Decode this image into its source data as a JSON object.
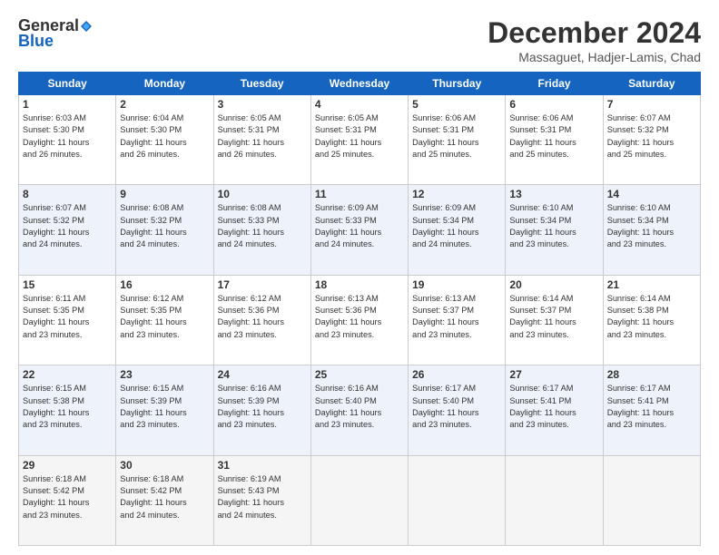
{
  "logo": {
    "line1": "General",
    "line2": "Blue"
  },
  "title": "December 2024",
  "subtitle": "Massaguet, Hadjer-Lamis, Chad",
  "headers": [
    "Sunday",
    "Monday",
    "Tuesday",
    "Wednesday",
    "Thursday",
    "Friday",
    "Saturday"
  ],
  "weeks": [
    [
      {
        "day": "1",
        "lines": [
          "Sunrise: 6:03 AM",
          "Sunset: 5:30 PM",
          "Daylight: 11 hours",
          "and 26 minutes."
        ]
      },
      {
        "day": "2",
        "lines": [
          "Sunrise: 6:04 AM",
          "Sunset: 5:30 PM",
          "Daylight: 11 hours",
          "and 26 minutes."
        ]
      },
      {
        "day": "3",
        "lines": [
          "Sunrise: 6:05 AM",
          "Sunset: 5:31 PM",
          "Daylight: 11 hours",
          "and 26 minutes."
        ]
      },
      {
        "day": "4",
        "lines": [
          "Sunrise: 6:05 AM",
          "Sunset: 5:31 PM",
          "Daylight: 11 hours",
          "and 25 minutes."
        ]
      },
      {
        "day": "5",
        "lines": [
          "Sunrise: 6:06 AM",
          "Sunset: 5:31 PM",
          "Daylight: 11 hours",
          "and 25 minutes."
        ]
      },
      {
        "day": "6",
        "lines": [
          "Sunrise: 6:06 AM",
          "Sunset: 5:31 PM",
          "Daylight: 11 hours",
          "and 25 minutes."
        ]
      },
      {
        "day": "7",
        "lines": [
          "Sunrise: 6:07 AM",
          "Sunset: 5:32 PM",
          "Daylight: 11 hours",
          "and 25 minutes."
        ]
      }
    ],
    [
      {
        "day": "8",
        "lines": [
          "Sunrise: 6:07 AM",
          "Sunset: 5:32 PM",
          "Daylight: 11 hours",
          "and 24 minutes."
        ]
      },
      {
        "day": "9",
        "lines": [
          "Sunrise: 6:08 AM",
          "Sunset: 5:32 PM",
          "Daylight: 11 hours",
          "and 24 minutes."
        ]
      },
      {
        "day": "10",
        "lines": [
          "Sunrise: 6:08 AM",
          "Sunset: 5:33 PM",
          "Daylight: 11 hours",
          "and 24 minutes."
        ]
      },
      {
        "day": "11",
        "lines": [
          "Sunrise: 6:09 AM",
          "Sunset: 5:33 PM",
          "Daylight: 11 hours",
          "and 24 minutes."
        ]
      },
      {
        "day": "12",
        "lines": [
          "Sunrise: 6:09 AM",
          "Sunset: 5:34 PM",
          "Daylight: 11 hours",
          "and 24 minutes."
        ]
      },
      {
        "day": "13",
        "lines": [
          "Sunrise: 6:10 AM",
          "Sunset: 5:34 PM",
          "Daylight: 11 hours",
          "and 23 minutes."
        ]
      },
      {
        "day": "14",
        "lines": [
          "Sunrise: 6:10 AM",
          "Sunset: 5:34 PM",
          "Daylight: 11 hours",
          "and 23 minutes."
        ]
      }
    ],
    [
      {
        "day": "15",
        "lines": [
          "Sunrise: 6:11 AM",
          "Sunset: 5:35 PM",
          "Daylight: 11 hours",
          "and 23 minutes."
        ]
      },
      {
        "day": "16",
        "lines": [
          "Sunrise: 6:12 AM",
          "Sunset: 5:35 PM",
          "Daylight: 11 hours",
          "and 23 minutes."
        ]
      },
      {
        "day": "17",
        "lines": [
          "Sunrise: 6:12 AM",
          "Sunset: 5:36 PM",
          "Daylight: 11 hours",
          "and 23 minutes."
        ]
      },
      {
        "day": "18",
        "lines": [
          "Sunrise: 6:13 AM",
          "Sunset: 5:36 PM",
          "Daylight: 11 hours",
          "and 23 minutes."
        ]
      },
      {
        "day": "19",
        "lines": [
          "Sunrise: 6:13 AM",
          "Sunset: 5:37 PM",
          "Daylight: 11 hours",
          "and 23 minutes."
        ]
      },
      {
        "day": "20",
        "lines": [
          "Sunrise: 6:14 AM",
          "Sunset: 5:37 PM",
          "Daylight: 11 hours",
          "and 23 minutes."
        ]
      },
      {
        "day": "21",
        "lines": [
          "Sunrise: 6:14 AM",
          "Sunset: 5:38 PM",
          "Daylight: 11 hours",
          "and 23 minutes."
        ]
      }
    ],
    [
      {
        "day": "22",
        "lines": [
          "Sunrise: 6:15 AM",
          "Sunset: 5:38 PM",
          "Daylight: 11 hours",
          "and 23 minutes."
        ]
      },
      {
        "day": "23",
        "lines": [
          "Sunrise: 6:15 AM",
          "Sunset: 5:39 PM",
          "Daylight: 11 hours",
          "and 23 minutes."
        ]
      },
      {
        "day": "24",
        "lines": [
          "Sunrise: 6:16 AM",
          "Sunset: 5:39 PM",
          "Daylight: 11 hours",
          "and 23 minutes."
        ]
      },
      {
        "day": "25",
        "lines": [
          "Sunrise: 6:16 AM",
          "Sunset: 5:40 PM",
          "Daylight: 11 hours",
          "and 23 minutes."
        ]
      },
      {
        "day": "26",
        "lines": [
          "Sunrise: 6:17 AM",
          "Sunset: 5:40 PM",
          "Daylight: 11 hours",
          "and 23 minutes."
        ]
      },
      {
        "day": "27",
        "lines": [
          "Sunrise: 6:17 AM",
          "Sunset: 5:41 PM",
          "Daylight: 11 hours",
          "and 23 minutes."
        ]
      },
      {
        "day": "28",
        "lines": [
          "Sunrise: 6:17 AM",
          "Sunset: 5:41 PM",
          "Daylight: 11 hours",
          "and 23 minutes."
        ]
      }
    ],
    [
      {
        "day": "29",
        "lines": [
          "Sunrise: 6:18 AM",
          "Sunset: 5:42 PM",
          "Daylight: 11 hours",
          "and 23 minutes."
        ]
      },
      {
        "day": "30",
        "lines": [
          "Sunrise: 6:18 AM",
          "Sunset: 5:42 PM",
          "Daylight: 11 hours",
          "and 24 minutes."
        ]
      },
      {
        "day": "31",
        "lines": [
          "Sunrise: 6:19 AM",
          "Sunset: 5:43 PM",
          "Daylight: 11 hours",
          "and 24 minutes."
        ]
      },
      null,
      null,
      null,
      null
    ]
  ],
  "row_styles": [
    "row-odd",
    "row-even",
    "row-odd",
    "row-even",
    "row-last"
  ]
}
